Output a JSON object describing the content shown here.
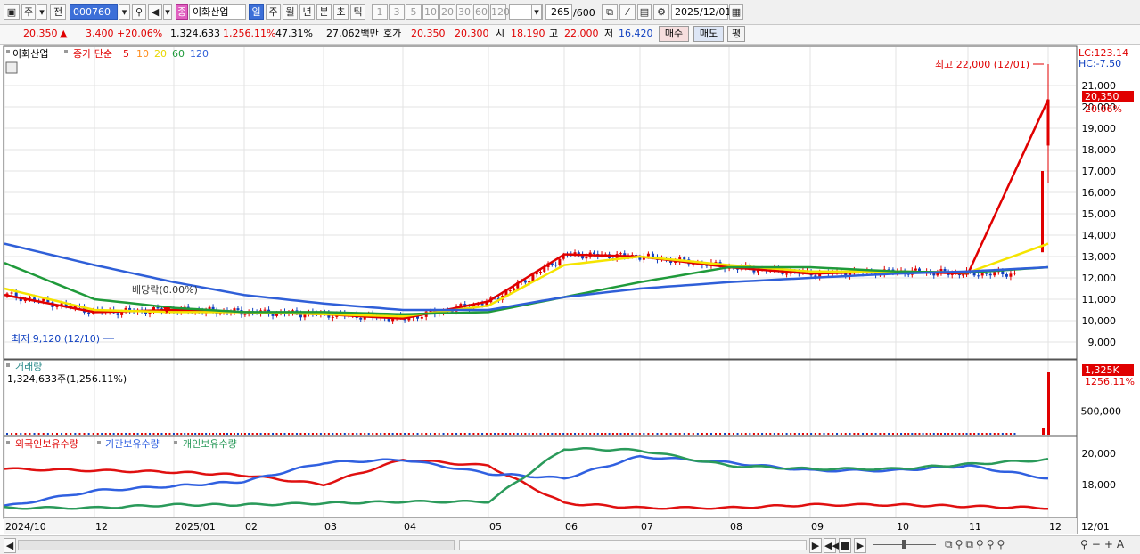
{
  "toolbar": {
    "code": "000760",
    "market_tag": "주",
    "prev_tag": "전",
    "stock_badge": "종",
    "stock_name": "이화산업",
    "period_tabs": [
      "일",
      "주",
      "월",
      "년",
      "분",
      "초",
      "틱"
    ],
    "active_period": "일",
    "intervals": [
      "1",
      "3",
      "5",
      "10",
      "20",
      "30",
      "60",
      "120"
    ],
    "count": "265",
    "count_total": "/600",
    "date": "2025/12/01"
  },
  "quote": {
    "price": "20,350",
    "change": "3,400",
    "change_pct": "+20.06%",
    "volume": "1,324,633",
    "volume_ratio": "1,256.11%",
    "turnover_pct": "47.31%",
    "amount": "27,062백만",
    "hoga_label": "호가",
    "ask": "20,350",
    "bid": "20,300",
    "open_label": "시",
    "open": "18,190",
    "high_label": "고",
    "high": "22,000",
    "low_label": "저",
    "low": "16,420",
    "buy_label": "매수",
    "sell_label": "매도",
    "avg_label": "평"
  },
  "price_panel": {
    "stock_label": "이화산업",
    "ma_title": "종가 단순",
    "ma_periods": [
      "5",
      "10",
      "20",
      "60",
      "120"
    ],
    "lc_label": "LC:123.14",
    "hc_label": "HC:-7.50",
    "current_price_tag": "20,350",
    "current_pct_tag": "20.06%",
    "high_annotation": "최고 22,000 (12/01)",
    "low_annotation": "최저 9,120 (12/10)",
    "dividend_annotation": "배당락(0.00%)",
    "yaxis_labels": [
      "21,000",
      "20,000",
      "19,000",
      "18,000",
      "17,000",
      "16,000",
      "15,000",
      "14,000",
      "13,000",
      "12,000",
      "11,000",
      "10,000",
      "9,000"
    ]
  },
  "volume_panel": {
    "title": "거래량",
    "value_text": "1,324,633주(1,256.11%)",
    "tag": "1,325K",
    "tag_pct": "1256.11%",
    "yaxis_labels": [
      "500,000"
    ]
  },
  "holdings_panel": {
    "legend": [
      "외국인보유수량",
      "기관보유수량",
      "개인보유수량"
    ],
    "yaxis_labels": [
      "20,000",
      "18,000"
    ]
  },
  "xaxis_labels": [
    "2024/10",
    "12",
    "2025/01",
    "02",
    "03",
    "04",
    "05",
    "06",
    "07",
    "08",
    "09",
    "10",
    "11",
    "12",
    "12/01"
  ],
  "colors": {
    "up": "#e00000",
    "down": "#1040c0",
    "ma5": "#e00000",
    "ma10": "#ff8c1a",
    "ma20": "#f5e400",
    "ma60": "#1f9a3a",
    "ma120": "#2f5fd8",
    "foreign": "#e01010",
    "institution": "#3060e0",
    "individual": "#2a9a5a"
  },
  "chart_data": [
    {
      "type": "line",
      "title": "이화산업 종가 단순",
      "x": [
        "2024/10",
        "2024/12",
        "2025/01",
        "2025/02",
        "2025/03",
        "2025/04",
        "2025/05",
        "2025/06",
        "2025/07",
        "2025/08",
        "2025/09",
        "2025/10",
        "2025/11",
        "2025/12/01"
      ],
      "series": [
        {
          "name": "5",
          "values": [
            11200,
            10400,
            10500,
            10400,
            10300,
            10100,
            10900,
            13100,
            13000,
            12500,
            12200,
            12300,
            12200,
            20350
          ]
        },
        {
          "name": "20",
          "values": [
            11500,
            10500,
            10400,
            10400,
            10300,
            10200,
            10700,
            12600,
            13000,
            12600,
            12300,
            12300,
            12250,
            13600
          ]
        },
        {
          "name": "60",
          "values": [
            12700,
            11000,
            10600,
            10400,
            10400,
            10300,
            10400,
            11100,
            11800,
            12500,
            12500,
            12300,
            12250,
            12500
          ]
        },
        {
          "name": "120",
          "values": [
            13600,
            12600,
            11800,
            11200,
            10800,
            10500,
            10500,
            11100,
            11500,
            11800,
            12000,
            12200,
            12300,
            12500
          ]
        }
      ],
      "ylim": [
        8700,
        22700
      ],
      "annotations": [
        "최고 22,000 (12/01)",
        "최저 9,120 (12/10)",
        "배당락(0.00%)"
      ]
    },
    {
      "type": "bar",
      "title": "거래량",
      "x": [
        "2025/12/01"
      ],
      "values": [
        1324633
      ],
      "ylim": [
        0,
        1400000
      ]
    },
    {
      "type": "line",
      "title": "외국인보유수량 / 기관보유수량 / 개인보유수량",
      "x": [
        "2024/10",
        "2024/12",
        "2025/01",
        "2025/02",
        "2025/03",
        "2025/04",
        "2025/05",
        "2025/06",
        "2025/07",
        "2025/08",
        "2025/09",
        "2025/10",
        "2025/11",
        "2025/12/01"
      ],
      "series": [
        {
          "name": "외국인보유수량",
          "values": [
            19000,
            18900,
            18800,
            18600,
            18000,
            19600,
            19200,
            16800,
            16500,
            16500,
            16700,
            16700,
            16600,
            16500
          ]
        },
        {
          "name": "기관보유수량",
          "values": [
            16600,
            17600,
            17900,
            18200,
            19400,
            19600,
            18700,
            18400,
            19800,
            19400,
            18900,
            18900,
            19200,
            18400
          ]
        },
        {
          "name": "개인보유수량",
          "values": [
            16500,
            16500,
            16700,
            16700,
            16800,
            16900,
            16900,
            20300,
            20200,
            19200,
            19000,
            19000,
            19300,
            19600
          ]
        }
      ],
      "ylim": [
        16400,
        21000
      ]
    }
  ]
}
